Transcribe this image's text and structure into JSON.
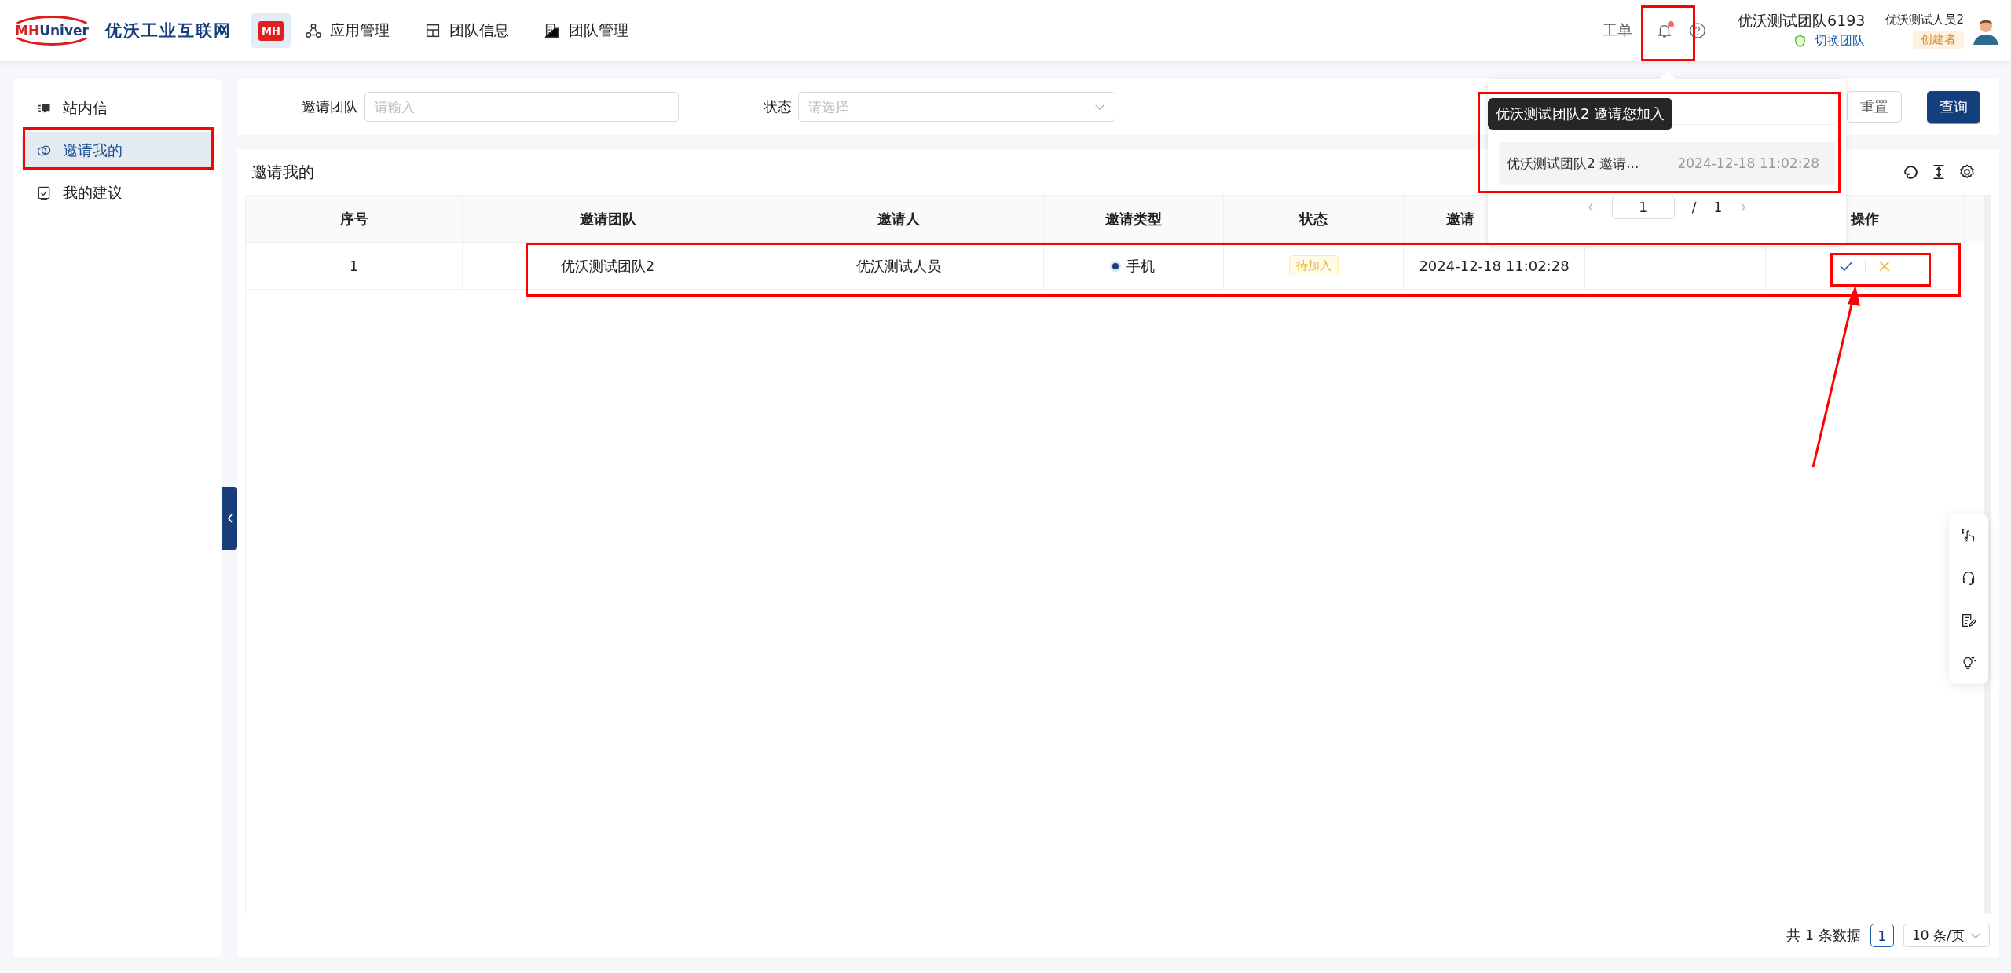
{
  "header": {
    "wordmark": [
      "MH",
      "Univer"
    ],
    "logo_text": "优沃工业互联网",
    "app_icon": "MH",
    "nav": [
      {
        "label": "应用管理"
      },
      {
        "label": "团队信息"
      },
      {
        "label": "团队管理"
      }
    ],
    "ticket": "工单",
    "bell": {
      "unread": true
    },
    "team": {
      "name": "优沃测试团队6193",
      "switch": "切换团队"
    },
    "user": {
      "name": "优沃测试人员2",
      "role": "创建者"
    }
  },
  "sidebar": {
    "items": [
      {
        "label": "站内信",
        "selected": false
      },
      {
        "label": "邀请我的",
        "selected": true
      },
      {
        "label": "我的建议",
        "selected": false
      }
    ]
  },
  "filter": {
    "fields": [
      {
        "label": "邀请团队",
        "placeholder": "请输入",
        "kind": "input"
      },
      {
        "label": "状态",
        "placeholder": "请选择",
        "kind": "select"
      }
    ],
    "buttons": [
      {
        "label": "重置",
        "kind": "default"
      },
      {
        "label": "查询",
        "kind": "primary"
      }
    ]
  },
  "table": {
    "title": "邀请我的",
    "columns": [
      "序号",
      "邀请团队",
      "邀请人",
      "邀请类型",
      "状态",
      "邀请",
      "操作"
    ],
    "rows": [
      {
        "index": "1",
        "team": "优沃测试团队2",
        "inviter": "优沃测试人员",
        "type": "手机",
        "status": "待加入",
        "time": "2024-12-18 11:02:28"
      }
    ]
  },
  "pagination": {
    "total": "共 1 条数据",
    "page": "1",
    "page_size": "10 条/页"
  },
  "popup": {
    "tooltip": "优沃测试团队2 邀请您加入",
    "items": [
      {
        "text": "优沃测试团队2 邀请...",
        "time": "2024-12-18 11:02:28"
      }
    ],
    "pager": {
      "page": "1",
      "separator": "/",
      "total": "1"
    }
  }
}
